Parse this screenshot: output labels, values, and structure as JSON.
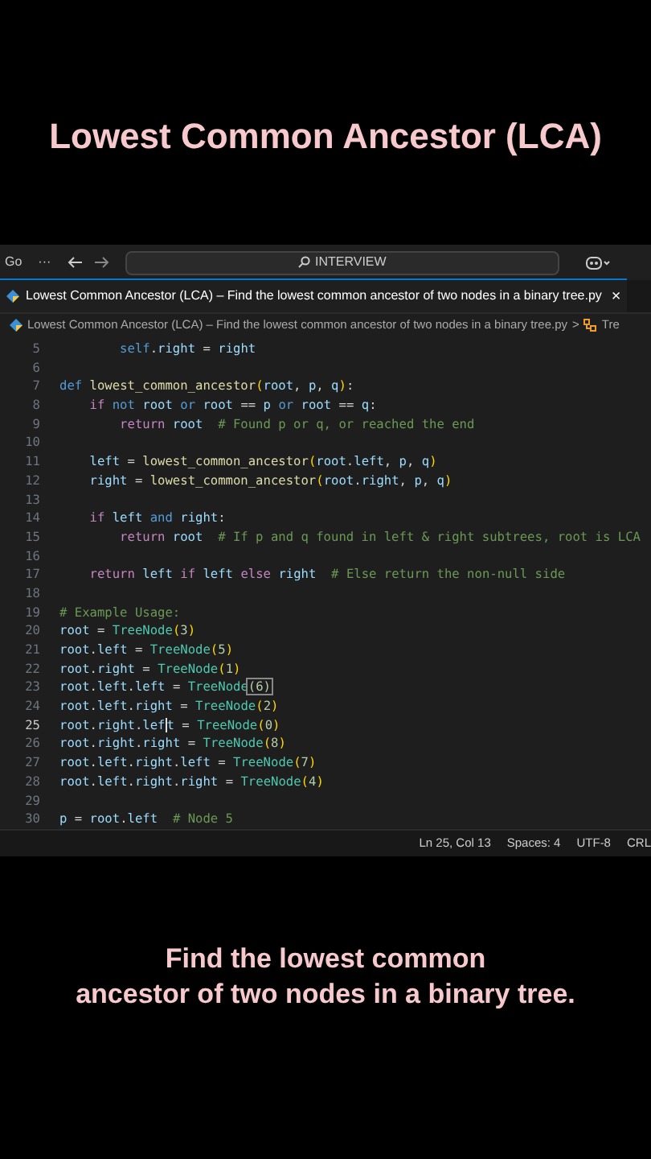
{
  "headline": "Lowest Common Ancestor (LCA)",
  "titlebar": {
    "menu": "Go",
    "more": "···",
    "search": "INTERVIEW"
  },
  "tab": {
    "label": "Lowest Common Ancestor (LCA) – Find the lowest common ancestor of two nodes in a binary tree.py",
    "close": "×",
    "selected": true
  },
  "breadcrumb": {
    "file": "Lowest Common Ancestor (LCA) – Find the lowest common ancestor of two nodes in a binary tree.py",
    "separator": ">",
    "symbol": "Tre"
  },
  "lines": [
    {
      "number": "5",
      "current": false,
      "tokens": [
        {
          "text": "        self",
          "kind": "d"
        },
        {
          "text": ".",
          "kind": "o"
        },
        {
          "text": "right",
          "kind": "v"
        },
        {
          "text": " = ",
          "kind": "o"
        },
        {
          "text": "right",
          "kind": "v"
        }
      ]
    },
    {
      "number": "6",
      "current": false
    },
    {
      "number": "7",
      "current": false,
      "tokens": [
        {
          "text": "def",
          "kind": "d"
        },
        {
          "text": " lowest_common_ancestor",
          "kind": "f"
        },
        {
          "text": "(",
          "kind": "p"
        },
        {
          "text": "root",
          "kind": "v"
        },
        {
          "text": ", ",
          "kind": "o"
        },
        {
          "text": "p",
          "kind": "v"
        },
        {
          "text": ", ",
          "kind": "o"
        },
        {
          "text": "q",
          "kind": "v"
        },
        {
          "text": ")",
          "kind": "p"
        },
        {
          "text": ":",
          "kind": "o"
        }
      ]
    },
    {
      "number": "8",
      "current": false,
      "tokens": [
        {
          "text": "    if",
          "kind": "k"
        },
        {
          "text": " not",
          "kind": "d"
        },
        {
          "text": " root",
          "kind": "v"
        },
        {
          "text": " or",
          "kind": "d"
        },
        {
          "text": " root",
          "kind": "v"
        },
        {
          "text": " == ",
          "kind": "o"
        },
        {
          "text": "p",
          "kind": "v"
        },
        {
          "text": " or",
          "kind": "d"
        },
        {
          "text": " root",
          "kind": "v"
        },
        {
          "text": " == ",
          "kind": "o"
        },
        {
          "text": "q",
          "kind": "v"
        },
        {
          "text": ":",
          "kind": "o"
        }
      ]
    },
    {
      "number": "9",
      "current": false,
      "tokens": [
        {
          "text": "        return",
          "kind": "k"
        },
        {
          "text": " root",
          "kind": "v"
        },
        {
          "text": "  # Found p or q, or reached the end",
          "kind": "c"
        }
      ]
    },
    {
      "number": "10",
      "current": false
    },
    {
      "number": "11",
      "current": false,
      "tokens": [
        {
          "text": "    left",
          "kind": "v"
        },
        {
          "text": " = ",
          "kind": "o"
        },
        {
          "text": "lowest_common_ancestor",
          "kind": "f"
        },
        {
          "text": "(",
          "kind": "p"
        },
        {
          "text": "root",
          "kind": "v"
        },
        {
          "text": ".",
          "kind": "o"
        },
        {
          "text": "left",
          "kind": "v"
        },
        {
          "text": ", ",
          "kind": "o"
        },
        {
          "text": "p",
          "kind": "v"
        },
        {
          "text": ", ",
          "kind": "o"
        },
        {
          "text": "q",
          "kind": "v"
        },
        {
          "text": ")",
          "kind": "p"
        }
      ]
    },
    {
      "number": "12",
      "current": false,
      "tokens": [
        {
          "text": "    right",
          "kind": "v"
        },
        {
          "text": " = ",
          "kind": "o"
        },
        {
          "text": "lowest_common_ancestor",
          "kind": "f"
        },
        {
          "text": "(",
          "kind": "p"
        },
        {
          "text": "root",
          "kind": "v"
        },
        {
          "text": ".",
          "kind": "o"
        },
        {
          "text": "right",
          "kind": "v"
        },
        {
          "text": ", ",
          "kind": "o"
        },
        {
          "text": "p",
          "kind": "v"
        },
        {
          "text": ", ",
          "kind": "o"
        },
        {
          "text": "q",
          "kind": "v"
        },
        {
          "text": ")",
          "kind": "p"
        }
      ]
    },
    {
      "number": "13",
      "current": false
    },
    {
      "number": "14",
      "current": false,
      "tokens": [
        {
          "text": "    if",
          "kind": "k"
        },
        {
          "text": " left",
          "kind": "v"
        },
        {
          "text": " and",
          "kind": "d"
        },
        {
          "text": " right",
          "kind": "v"
        },
        {
          "text": ":",
          "kind": "o"
        }
      ]
    },
    {
      "number": "15",
      "current": false,
      "tokens": [
        {
          "text": "        return",
          "kind": "k"
        },
        {
          "text": " root",
          "kind": "v"
        },
        {
          "text": "  # If p and q found in left & right subtrees, root is LCA",
          "kind": "c"
        }
      ]
    },
    {
      "number": "16",
      "current": false
    },
    {
      "number": "17",
      "current": false,
      "tokens": [
        {
          "text": "    return",
          "kind": "k"
        },
        {
          "text": " left",
          "kind": "v"
        },
        {
          "text": " if",
          "kind": "k"
        },
        {
          "text": " left",
          "kind": "v"
        },
        {
          "text": " else",
          "kind": "k"
        },
        {
          "text": " right",
          "kind": "v"
        },
        {
          "text": "  # Else return the non-null side",
          "kind": "c"
        }
      ]
    },
    {
      "number": "18",
      "current": false
    },
    {
      "number": "19",
      "current": false,
      "tokens": [
        {
          "text": "# Example Usage:",
          "kind": "c"
        }
      ]
    },
    {
      "number": "20",
      "current": false,
      "tokens": [
        {
          "text": "root",
          "kind": "v"
        },
        {
          "text": " = ",
          "kind": "o"
        },
        {
          "text": "TreeNode",
          "kind": "t"
        },
        {
          "text": "(",
          "kind": "p"
        },
        {
          "text": "3",
          "kind": "n"
        },
        {
          "text": ")",
          "kind": "p"
        }
      ]
    },
    {
      "number": "21",
      "current": false,
      "tokens": [
        {
          "text": "root",
          "kind": "v"
        },
        {
          "text": ".",
          "kind": "o"
        },
        {
          "text": "left",
          "kind": "v"
        },
        {
          "text": " = ",
          "kind": "o"
        },
        {
          "text": "TreeNode",
          "kind": "t"
        },
        {
          "text": "(",
          "kind": "p"
        },
        {
          "text": "5",
          "kind": "n"
        },
        {
          "text": ")",
          "kind": "p"
        }
      ]
    },
    {
      "number": "22",
      "current": false,
      "tokens": [
        {
          "text": "root",
          "kind": "v"
        },
        {
          "text": ".",
          "kind": "o"
        },
        {
          "text": "right",
          "kind": "v"
        },
        {
          "text": " = ",
          "kind": "o"
        },
        {
          "text": "TreeNode",
          "kind": "t"
        },
        {
          "text": "(",
          "kind": "p"
        },
        {
          "text": "1",
          "kind": "n"
        },
        {
          "text": ")",
          "kind": "p"
        }
      ]
    },
    {
      "number": "23",
      "current": false,
      "tokens": [
        {
          "text": "root",
          "kind": "v"
        },
        {
          "text": ".",
          "kind": "o"
        },
        {
          "text": "left",
          "kind": "v"
        },
        {
          "text": ".",
          "kind": "o"
        },
        {
          "text": "left",
          "kind": "v"
        },
        {
          "text": " = ",
          "kind": "o"
        },
        {
          "text": "TreeNode",
          "kind": "t"
        },
        {
          "text": "(6)",
          "kind": "m"
        }
      ]
    },
    {
      "number": "24",
      "current": false,
      "tokens": [
        {
          "text": "root",
          "kind": "v"
        },
        {
          "text": ".",
          "kind": "o"
        },
        {
          "text": "left",
          "kind": "v"
        },
        {
          "text": ".",
          "kind": "o"
        },
        {
          "text": "right",
          "kind": "v"
        },
        {
          "text": " = ",
          "kind": "o"
        },
        {
          "text": "TreeNode",
          "kind": "t"
        },
        {
          "text": "(",
          "kind": "p"
        },
        {
          "text": "2",
          "kind": "n"
        },
        {
          "text": ")",
          "kind": "p"
        }
      ]
    },
    {
      "number": "25",
      "current": true,
      "tokens": [
        {
          "text": "root",
          "kind": "v"
        },
        {
          "text": ".",
          "kind": "o"
        },
        {
          "text": "right",
          "kind": "v"
        },
        {
          "text": ".",
          "kind": "o"
        },
        {
          "text": "lef",
          "kind": "v"
        },
        {
          "kind": "cursor"
        },
        {
          "text": "t",
          "kind": "v"
        },
        {
          "text": " = ",
          "kind": "o"
        },
        {
          "text": "TreeNode",
          "kind": "t"
        },
        {
          "text": "(",
          "kind": "p"
        },
        {
          "text": "0",
          "kind": "n"
        },
        {
          "text": ")",
          "kind": "p"
        }
      ]
    },
    {
      "number": "26",
      "current": false,
      "tokens": [
        {
          "text": "root",
          "kind": "v"
        },
        {
          "text": ".",
          "kind": "o"
        },
        {
          "text": "right",
          "kind": "v"
        },
        {
          "text": ".",
          "kind": "o"
        },
        {
          "text": "right",
          "kind": "v"
        },
        {
          "text": " = ",
          "kind": "o"
        },
        {
          "text": "TreeNode",
          "kind": "t"
        },
        {
          "text": "(",
          "kind": "p"
        },
        {
          "text": "8",
          "kind": "n"
        },
        {
          "text": ")",
          "kind": "p"
        }
      ]
    },
    {
      "number": "27",
      "current": false,
      "tokens": [
        {
          "text": "root",
          "kind": "v"
        },
        {
          "text": ".",
          "kind": "o"
        },
        {
          "text": "left",
          "kind": "v"
        },
        {
          "text": ".",
          "kind": "o"
        },
        {
          "text": "right",
          "kind": "v"
        },
        {
          "text": ".",
          "kind": "o"
        },
        {
          "text": "left",
          "kind": "v"
        },
        {
          "text": " = ",
          "kind": "o"
        },
        {
          "text": "TreeNode",
          "kind": "t"
        },
        {
          "text": "(",
          "kind": "p"
        },
        {
          "text": "7",
          "kind": "n"
        },
        {
          "text": ")",
          "kind": "p"
        }
      ]
    },
    {
      "number": "28",
      "current": false,
      "tokens": [
        {
          "text": "root",
          "kind": "v"
        },
        {
          "text": ".",
          "kind": "o"
        },
        {
          "text": "left",
          "kind": "v"
        },
        {
          "text": ".",
          "kind": "o"
        },
        {
          "text": "right",
          "kind": "v"
        },
        {
          "text": ".",
          "kind": "o"
        },
        {
          "text": "right",
          "kind": "v"
        },
        {
          "text": " = ",
          "kind": "o"
        },
        {
          "text": "TreeNode",
          "kind": "t"
        },
        {
          "text": "(",
          "kind": "p"
        },
        {
          "text": "4",
          "kind": "n"
        },
        {
          "text": ")",
          "kind": "p"
        }
      ]
    },
    {
      "number": "29",
      "current": false
    },
    {
      "number": "30",
      "current": false,
      "tokens": [
        {
          "text": "p",
          "kind": "v"
        },
        {
          "text": " = ",
          "kind": "o"
        },
        {
          "text": "root",
          "kind": "v"
        },
        {
          "text": ".",
          "kind": "o"
        },
        {
          "text": "left",
          "kind": "v"
        },
        {
          "text": "  # Node 5",
          "kind": "c"
        }
      ]
    }
  ],
  "status_bar": [
    "Ln 25, Col 13",
    "Spaces: 4",
    "UTF-8",
    "CRL"
  ],
  "caption": [
    "Find the lowest common",
    "ancestor of two nodes in a binary tree."
  ]
}
